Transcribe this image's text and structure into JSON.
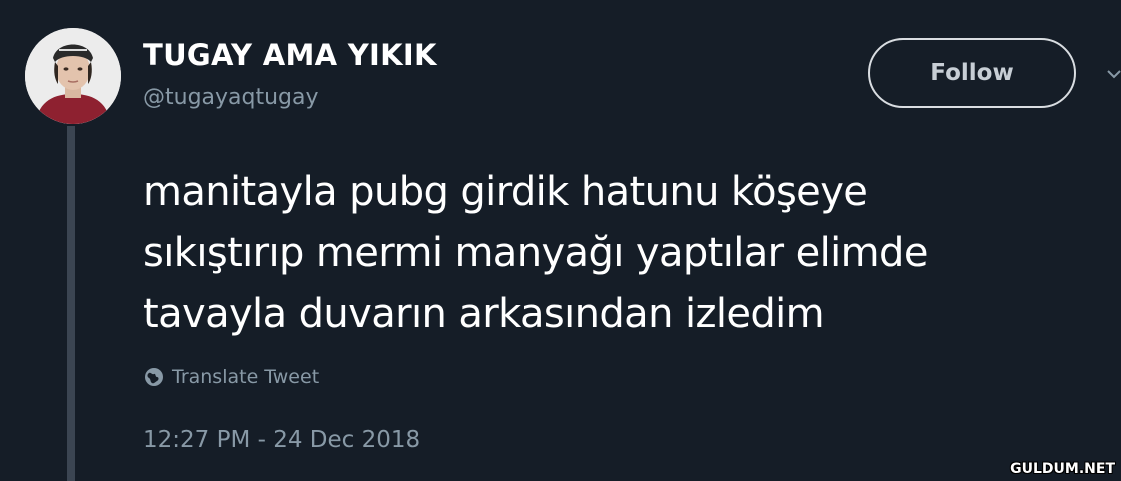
{
  "tweet": {
    "display_name": "TUGAY AMA YIKIK",
    "handle": "@tugayaqtugay",
    "follow_label": "Follow",
    "text": "manitayla pubg girdik hatunu köşeye\nsıkıştırıp mermi manyağı yaptılar elimde\ntavayla duvarın arkasından izledim",
    "translate_label": "Translate Tweet",
    "timestamp": "12:27 PM - 24 Dec 2018"
  },
  "icons": {
    "avatar": "profile-photo",
    "translate": "globe-icon",
    "menu": "chevron-down-icon"
  },
  "colors": {
    "background": "#151d27",
    "primary_text": "#ffffff",
    "secondary_text": "#8899a6",
    "thread_line": "#3b4552"
  },
  "watermark": "GULDUM.NET"
}
